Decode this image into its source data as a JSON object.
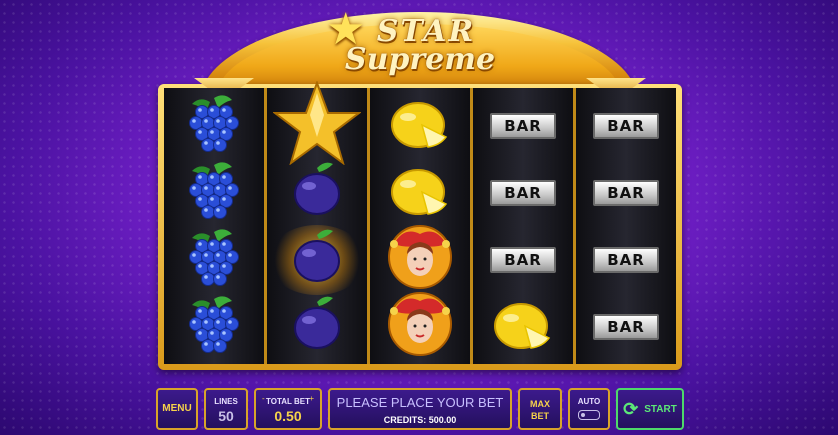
{
  "game": {
    "logo_top": "STAR",
    "logo_bottom": "Supreme"
  },
  "reels": [
    [
      "grapes",
      "grapes",
      "grapes",
      "grapes"
    ],
    [
      "star",
      "plum",
      "plum",
      "plum"
    ],
    [
      "lemon",
      "lemon",
      "joker",
      "joker"
    ],
    [
      "bar",
      "bar",
      "bar",
      "lemon"
    ],
    [
      "bar",
      "bar",
      "bar",
      "bar"
    ]
  ],
  "symbols": {
    "bar_label": "BAR"
  },
  "controls": {
    "menu_label": "MENU",
    "lines_label": "LINES",
    "lines_value": "50",
    "total_bet_label": "TOTAL BET",
    "total_bet_value": "0.50",
    "bet_minus": "-",
    "bet_plus": "+",
    "message": "PLEASE PLACE YOUR BET",
    "credits": "CREDITS: 500.00",
    "max_bet_line1": "MAX",
    "max_bet_line2": "BET",
    "auto_label": "AUTO",
    "start_label": "START"
  },
  "colors": {
    "accent_gold": "#f6d34a",
    "start_green": "#5ce878",
    "background_purple": "#7a22d0"
  }
}
